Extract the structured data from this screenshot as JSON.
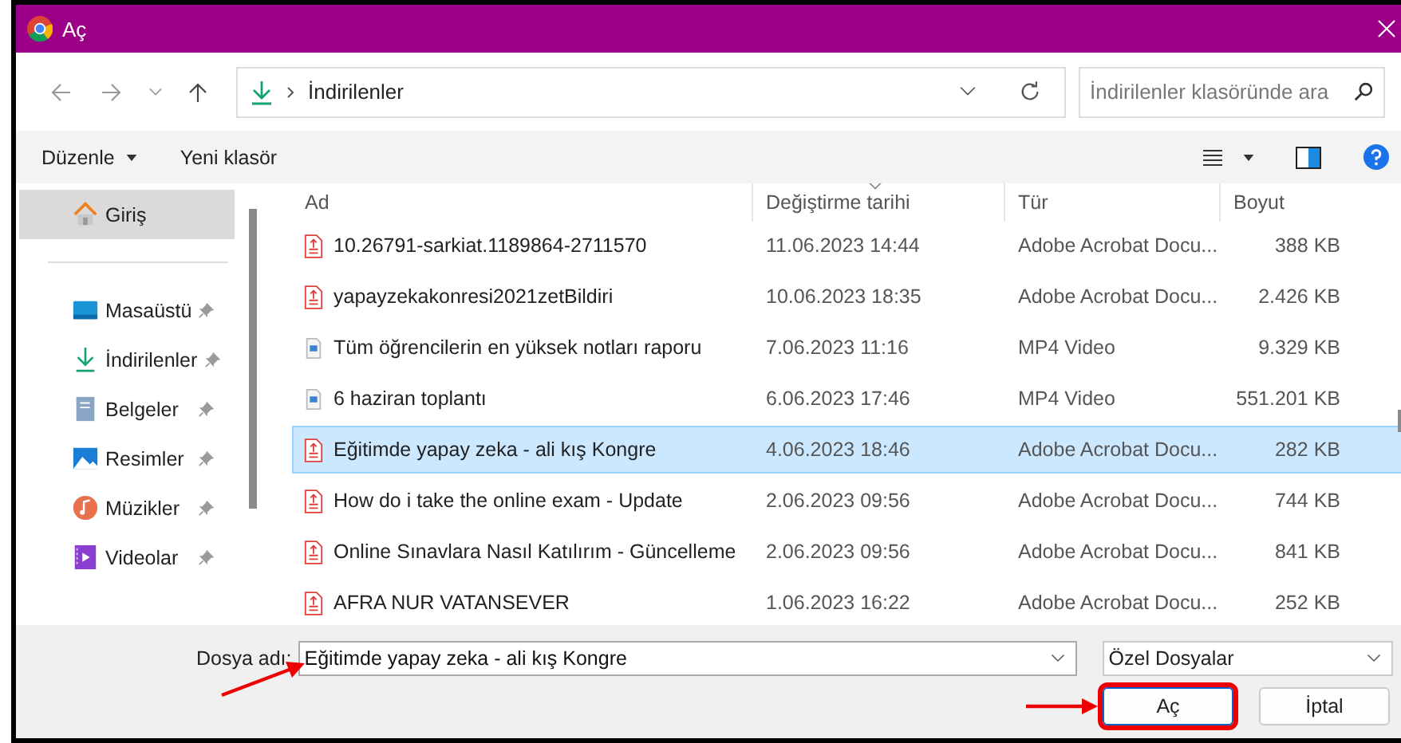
{
  "window": {
    "title": "Aç"
  },
  "navigation": {
    "path": [
      "İndirilenler"
    ],
    "search": {
      "placeholder": "İndirilenler klasöründe ara"
    }
  },
  "toolbar": {
    "items": [
      {
        "label": "Düzenle",
        "dropdown": true
      },
      {
        "label": "Yeni klasör",
        "dropdown": false
      }
    ]
  },
  "sidebar": {
    "items": [
      {
        "kind": "home",
        "label": "Giriş",
        "selected": true,
        "pinned": false
      },
      {
        "kind": "desktop",
        "label": "Masaüstü",
        "selected": false,
        "pinned": true
      },
      {
        "kind": "downloads",
        "label": "İndirilenler",
        "selected": false,
        "pinned": true
      },
      {
        "kind": "documents",
        "label": "Belgeler",
        "selected": false,
        "pinned": true
      },
      {
        "kind": "pictures",
        "label": "Resimler",
        "selected": false,
        "pinned": true
      },
      {
        "kind": "music",
        "label": "Müzikler",
        "selected": false,
        "pinned": true
      },
      {
        "kind": "videos",
        "label": "Videolar",
        "selected": false,
        "pinned": true
      }
    ]
  },
  "table": {
    "columns": [
      {
        "label": "Ad",
        "sorted": false
      },
      {
        "label": "Değiştirme tarihi",
        "sorted": true
      },
      {
        "label": "Tür",
        "sorted": false
      },
      {
        "label": "Boyut",
        "sorted": false
      }
    ],
    "rows": [
      {
        "kind": "pdf",
        "name": "10.26791-sarkiat.1189864-2711570",
        "date": "11.06.2023 14:44",
        "type": "Adobe Acrobat Docu...",
        "size": "388 KB",
        "selected": false
      },
      {
        "kind": "pdf",
        "name": "yapayzekakonresi2021zetBildiri",
        "date": "10.06.2023 18:35",
        "type": "Adobe Acrobat Docu...",
        "size": "2.426 KB",
        "selected": false
      },
      {
        "kind": "video",
        "name": "Tüm öğrencilerin en yüksek notları raporu",
        "date": "7.06.2023 11:16",
        "type": "MP4 Video",
        "size": "9.329 KB",
        "selected": false
      },
      {
        "kind": "video",
        "name": "6 haziran toplantı",
        "date": "6.06.2023 17:46",
        "type": "MP4 Video",
        "size": "551.201 KB",
        "selected": false
      },
      {
        "kind": "pdf",
        "name": "Eğitimde yapay zeka - ali kış Kongre",
        "date": "4.06.2023 18:46",
        "type": "Adobe Acrobat Docu...",
        "size": "282 KB",
        "selected": true
      },
      {
        "kind": "pdf",
        "name": "How do i take the online exam - Update",
        "date": "2.06.2023 09:56",
        "type": "Adobe Acrobat Docu...",
        "size": "744 KB",
        "selected": false
      },
      {
        "kind": "pdf",
        "name": "Online Sınavlara Nasıl Katılırım - Güncelleme",
        "date": "2.06.2023 09:56",
        "type": "Adobe Acrobat Docu...",
        "size": "841 KB",
        "selected": false
      },
      {
        "kind": "pdf",
        "name": "AFRA NUR VATANSEVER",
        "date": "1.06.2023 16:22",
        "type": "Adobe Acrobat Docu...",
        "size": "252 KB",
        "selected": false
      }
    ]
  },
  "footer": {
    "filename_label": "Dosya adı:",
    "filename": {
      "value": "Eğitimde yapay zeka - ali kış Kongre",
      "pointed": true
    },
    "filter": "Özel Dosyalar",
    "buttons": [
      {
        "label": "Aç",
        "highlighted": true,
        "pointed": true
      },
      {
        "label": "İptal",
        "highlighted": false,
        "pointed": false
      }
    ]
  }
}
